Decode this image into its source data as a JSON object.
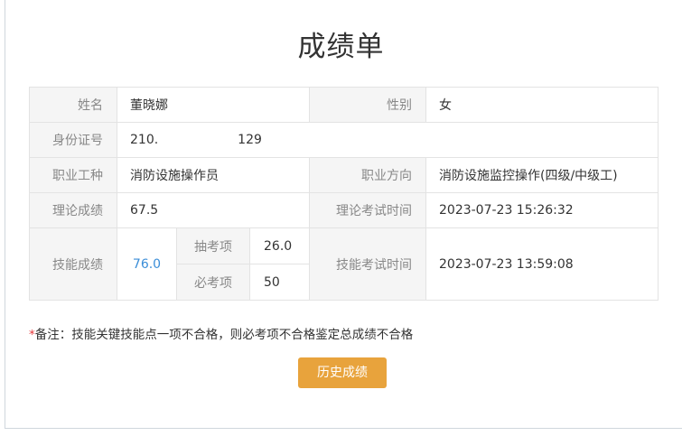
{
  "title": "成绩单",
  "labels": {
    "name": "姓名",
    "gender": "性别",
    "id_number": "身份证号",
    "occupation": "职业工种",
    "direction": "职业方向",
    "theory_score": "理论成绩",
    "theory_time": "理论考试时间",
    "skill_score": "技能成绩",
    "skill_time": "技能考试时间",
    "drawn_item": "抽考项",
    "required_item": "必考项"
  },
  "values": {
    "name": "董晓娜",
    "gender": "女",
    "id_prefix": "210.",
    "id_suffix": "129",
    "occupation": "消防设施操作员",
    "direction": "消防设施监控操作(四级/中级工)",
    "theory_score": "67.5",
    "theory_time": "2023-07-23 15:26:32",
    "skill_score": "76.0",
    "drawn_item_score": "26.0",
    "required_item_score": "50",
    "skill_time": "2023-07-23 13:59:08"
  },
  "note": {
    "marker": "*",
    "text": "备注：技能关键技能点一项不合格，则必考项不合格鉴定总成绩不合格"
  },
  "history_button": "历史成绩",
  "colors": {
    "label_bg": "#f5f5f5",
    "skill_score": "#3b8ed8",
    "button_bg": "#e8a33c",
    "note_marker": "#e4393c"
  }
}
